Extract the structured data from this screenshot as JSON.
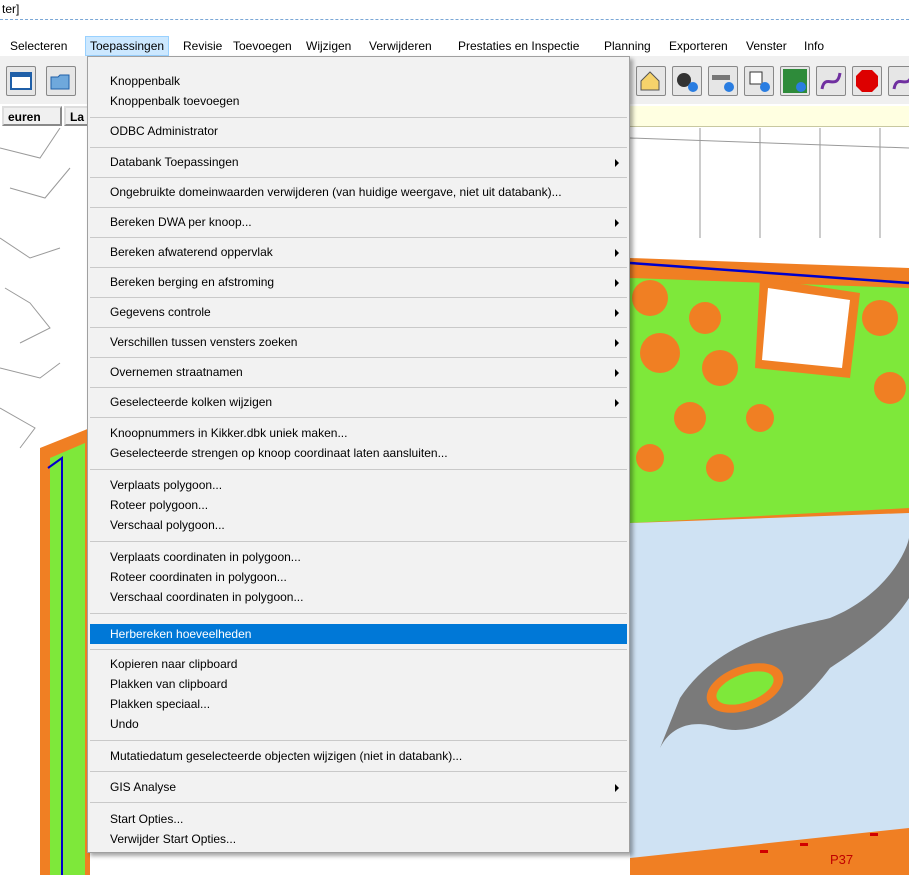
{
  "window": {
    "title_fragment": "ter]"
  },
  "menubar": {
    "items": [
      "Selecteren",
      "Toepassingen",
      "Revisie",
      "Toevoegen",
      "Wijzigen",
      "Verwijderen",
      "Prestaties en Inspectie",
      "Planning",
      "Exporteren",
      "Venster",
      "Info"
    ],
    "active": "Toepassingen"
  },
  "tabs": {
    "left": "euren",
    "second": "La"
  },
  "toolbar_icons": [
    "window-icon",
    "open-folder-icon",
    "house-info-icon",
    "network-info-icon",
    "pipe-info-icon",
    "grid-info-icon",
    "trees-info-icon",
    "curve-line-icon",
    "stop-sign-icon",
    "curve-line-icon"
  ],
  "dropdown": {
    "items": [
      {
        "label": "Knoppenbalk",
        "submenu": false
      },
      {
        "label": "Knoppenbalk toevoegen",
        "submenu": false
      },
      {
        "label": "ODBC Administrator",
        "submenu": false
      },
      {
        "label": "Databank Toepassingen",
        "submenu": true
      },
      {
        "label": "Ongebruikte domeinwaarden verwijderen (van huidige weergave, niet uit databank)...",
        "submenu": false
      },
      {
        "label": "Bereken DWA per knoop...",
        "submenu": true
      },
      {
        "label": "Bereken afwaterend oppervlak",
        "submenu": true
      },
      {
        "label": "Bereken berging en afstroming",
        "submenu": true
      },
      {
        "label": "Gegevens controle",
        "submenu": true
      },
      {
        "label": "Verschillen tussen vensters zoeken",
        "submenu": true
      },
      {
        "label": "Overnemen straatnamen",
        "submenu": true
      },
      {
        "label": "Geselecteerde kolken wijzigen",
        "submenu": true
      },
      {
        "label": "Knoopnummers in Kikker.dbk uniek maken...",
        "submenu": false
      },
      {
        "label": "Geselecteerde strengen op knoop coordinaat laten aansluiten...",
        "submenu": false
      },
      {
        "label": "Verplaats polygoon...",
        "submenu": false
      },
      {
        "label": "Roteer polygoon...",
        "submenu": false
      },
      {
        "label": "Verschaal polygoon...",
        "submenu": false
      },
      {
        "label": "Verplaats coordinaten in polygoon...",
        "submenu": false
      },
      {
        "label": "Roteer coordinaten in polygoon...",
        "submenu": false
      },
      {
        "label": "Verschaal coordinaten in polygoon...",
        "submenu": false
      },
      {
        "label": "Herbereken hoeveelheden",
        "submenu": false,
        "highlighted": true
      },
      {
        "label": "Kopieren naar clipboard",
        "submenu": false
      },
      {
        "label": "Plakken van clipboard",
        "submenu": false
      },
      {
        "label": "Plakken speciaal...",
        "submenu": false
      },
      {
        "label": "Undo",
        "submenu": false
      },
      {
        "label": "Mutatiedatum geselecteerde objecten wijzigen (niet in databank)...",
        "submenu": false
      },
      {
        "label": "GIS Analyse",
        "submenu": true
      },
      {
        "label": "Start Opties...",
        "submenu": false
      },
      {
        "label": "Verwijder Start Opties...",
        "submenu": false
      }
    ]
  },
  "map": {
    "label_p37": "P37"
  },
  "colors": {
    "orange": "#f07f23",
    "green": "#7ee83a",
    "water": "#cfe2f3",
    "road": "#7a7a7a",
    "highlight": "#0078d7",
    "boundary": "#0000cc"
  }
}
